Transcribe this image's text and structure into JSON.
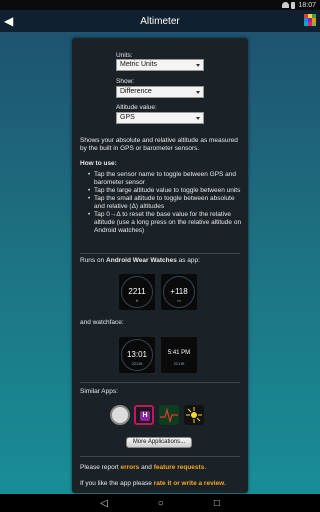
{
  "status_bar": {
    "time": "18:07"
  },
  "app_bar": {
    "title": "Altimeter"
  },
  "settings": {
    "units_label": "Units:",
    "units_value": "Metric Units",
    "show_label": "Show:",
    "show_value": "Difference",
    "altitude_label": "Altitude value:",
    "altitude_value": "GPS"
  },
  "description": "Shows your absolute and relative altitude as measured by the built in GPS or barometer sensors.",
  "howto": {
    "title": "How to use:",
    "items": [
      "Tap the sensor name to toggle between GPS and barometer sensor",
      "Tap the large altitude value to toggle between units",
      "Tap the small altitude to toggle between absolute and relative (Δ) altitudes",
      "Tap 0→Δ to reset the base value for the relative altitude (use a long press on the relative altitude on Android watches)"
    ]
  },
  "wear": {
    "prefix": "Runs on ",
    "brand": "Android Wear Watches",
    "suffix": " as app:",
    "app_watch1": {
      "value": "2211",
      "unit": "ft"
    },
    "app_watch2": {
      "value": "+118",
      "unit": "m"
    },
    "watchface_label": "and watchface:",
    "face_watch1": {
      "time": "13:01",
      "sub": "2211ft"
    },
    "face_watch2": {
      "time": "5:41 PM",
      "sub": "2211ft"
    }
  },
  "similar_apps": {
    "label": "Similar Apps:",
    "more_button": "More Applications..."
  },
  "footer": {
    "report_prefix": "Please report ",
    "errors": "errors",
    "and": " and ",
    "feature_requests": "feature requests",
    "report_suffix": ".",
    "like_prefix": "If you like the app please ",
    "rate": "rate it or write a review",
    "like_suffix": "."
  },
  "colors": {
    "accent": "#f5a623",
    "background_top": "#1f4f6f",
    "background_bottom": "#18909a"
  }
}
